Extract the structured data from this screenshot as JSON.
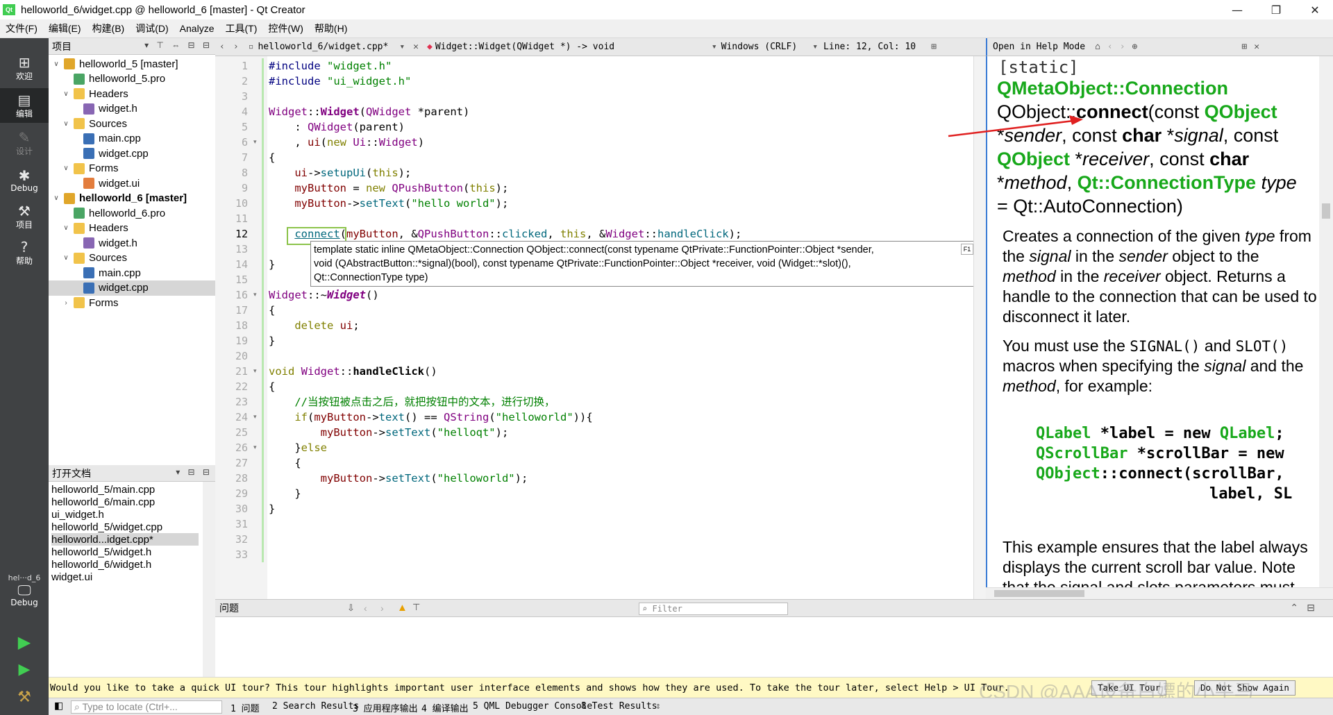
{
  "window": {
    "title": "helloworld_6/widget.cpp @ helloworld_6 [master] - Qt Creator",
    "minimize": "—",
    "maximize": "❐",
    "close": "✕",
    "logo": "Qt"
  },
  "menu": [
    "文件(F)",
    "编辑(E)",
    "构建(B)",
    "调试(D)",
    "Analyze",
    "工具(T)",
    "控件(W)",
    "帮助(H)"
  ],
  "modes": [
    {
      "label": "欢迎",
      "icon": "grid-icon"
    },
    {
      "label": "编辑",
      "icon": "edit-icon"
    },
    {
      "label": "设计",
      "icon": "pen-icon"
    },
    {
      "label": "Debug",
      "icon": "bug-icon"
    },
    {
      "label": "项目",
      "icon": "wrench-icon"
    },
    {
      "label": "帮助",
      "icon": "help-icon"
    }
  ],
  "kit": {
    "name": "hel···d_6",
    "label": "Debug"
  },
  "project_pane": {
    "title": "项目",
    "tree": [
      {
        "label": "helloworld_5 [master]",
        "depth": 0,
        "arrow": "∨",
        "icon": "proj",
        "bold": false
      },
      {
        "label": "helloworld_5.pro",
        "depth": 1,
        "arrow": "",
        "icon": "pro"
      },
      {
        "label": "Headers",
        "depth": 1,
        "arrow": "∨",
        "icon": "folder"
      },
      {
        "label": "widget.h",
        "depth": 2,
        "arrow": "",
        "icon": "h"
      },
      {
        "label": "Sources",
        "depth": 1,
        "arrow": "∨",
        "icon": "folder"
      },
      {
        "label": "main.cpp",
        "depth": 2,
        "arrow": "",
        "icon": "cpp"
      },
      {
        "label": "widget.cpp",
        "depth": 2,
        "arrow": "",
        "icon": "cpp"
      },
      {
        "label": "Forms",
        "depth": 1,
        "arrow": "∨",
        "icon": "folder"
      },
      {
        "label": "widget.ui",
        "depth": 2,
        "arrow": "",
        "icon": "ui"
      },
      {
        "label": "helloworld_6 [master]",
        "depth": 0,
        "arrow": "∨",
        "icon": "proj",
        "bold": true
      },
      {
        "label": "helloworld_6.pro",
        "depth": 1,
        "arrow": "",
        "icon": "pro"
      },
      {
        "label": "Headers",
        "depth": 1,
        "arrow": "∨",
        "icon": "folder"
      },
      {
        "label": "widget.h",
        "depth": 2,
        "arrow": "",
        "icon": "h"
      },
      {
        "label": "Sources",
        "depth": 1,
        "arrow": "∨",
        "icon": "folder"
      },
      {
        "label": "main.cpp",
        "depth": 2,
        "arrow": "",
        "icon": "cpp"
      },
      {
        "label": "widget.cpp",
        "depth": 2,
        "arrow": "",
        "icon": "cpp",
        "selected": true
      },
      {
        "label": "Forms",
        "depth": 1,
        "arrow": "›",
        "icon": "folder"
      }
    ]
  },
  "open_docs": {
    "title": "打开文档",
    "items": [
      {
        "label": "helloworld_5/main.cpp"
      },
      {
        "label": "helloworld_6/main.cpp"
      },
      {
        "label": "ui_widget.h"
      },
      {
        "label": "helloworld_5/widget.cpp"
      },
      {
        "label": "helloworld...idget.cpp*",
        "selected": true
      },
      {
        "label": "helloworld_5/widget.h"
      },
      {
        "label": "helloworld_6/widget.h"
      },
      {
        "label": "widget.ui"
      }
    ]
  },
  "editor": {
    "file": "helloworld_6/widget.cpp*",
    "symbol": "Widget::Widget(QWidget *) -> void",
    "encoding": "Windows (CRLF)",
    "position": "Line: 12, Col: 10",
    "line_numbers": [
      "1",
      "2",
      "3",
      "4",
      "5",
      "6",
      "7",
      "8",
      "9",
      "10",
      "11",
      "12",
      "13",
      "14",
      "15",
      "16",
      "17",
      "18",
      "19",
      "20",
      "21",
      "22",
      "23",
      "24",
      "25",
      "26",
      "27",
      "28",
      "29",
      "30",
      "31",
      "32",
      "33"
    ],
    "code": {
      "l1a": "#include",
      "l1b": " \"widget.h\"",
      "l2a": "#include",
      "l2b": " \"ui_widget.h\"",
      "l4a": "Widget",
      "l4b": "::",
      "l4c": "Widget",
      "l4d": "(",
      "l4e": "QWidget",
      "l4f": " *parent)",
      "l5a": "    : ",
      "l5b": "QWidget",
      "l5c": "(parent)",
      "l6a": "    , ",
      "l6b": "ui",
      "l6c": "(",
      "l6d": "new",
      "l6e": " ",
      "l6f": "Ui",
      "l6g": "::",
      "l6h": "Widget",
      "l6i": ")",
      "l7": "{",
      "l8a": "    ",
      "l8b": "ui",
      "l8c": "->",
      "l8d": "setupUi",
      "l8e": "(",
      "l8f": "this",
      "l8g": ");",
      "l9a": "    ",
      "l9b": "myButton",
      "l9c": " = ",
      "l9d": "new",
      "l9e": " ",
      "l9f": "QPushButton",
      "l9g": "(",
      "l9h": "this",
      "l9i": ");",
      "l10a": "    ",
      "l10b": "myButton",
      "l10c": "->",
      "l10d": "setText",
      "l10e": "(",
      "l10f": "\"hello world\"",
      "l10g": ");",
      "l12a": "    ",
      "l12b": "connect",
      "l12c": "(",
      "l12d": "myButton",
      "l12e": ", &",
      "l12f": "QPushButton",
      "l12g": "::",
      "l12h": "clicked",
      "l12i": ", ",
      "l12j": "this",
      "l12k": ", &",
      "l12l": "Widget",
      "l12m": "::",
      "l12n": "handleClick",
      "l12o": ");",
      "l14": "}",
      "l16a": "Widget",
      "l16b": "::~",
      "l16c": "Widget",
      "l16d": "()",
      "l17": "{",
      "l18a": "    ",
      "l18b": "delete",
      "l18c": " ",
      "l18d": "ui",
      "l18e": ";",
      "l19": "}",
      "l21a": "void",
      "l21b": " ",
      "l21c": "Widget",
      "l21d": "::",
      "l21e": "handleClick",
      "l21f": "()",
      "l22": "{",
      "l23": "    //当按钮被点击之后，就把按钮中的文本，进行切换，",
      "l24a": "    ",
      "l24b": "if",
      "l24c": "(",
      "l24d": "myButton",
      "l24e": "->",
      "l24f": "text",
      "l24g": "() == ",
      "l24h": "QString",
      "l24i": "(",
      "l24j": "\"helloworld\"",
      "l24k": ")){",
      "l25a": "        ",
      "l25b": "myButton",
      "l25c": "->",
      "l25d": "setText",
      "l25e": "(",
      "l25f": "\"helloqt\"",
      "l25g": ");",
      "l26a": "    }",
      "l26b": "else",
      "l27": "    {",
      "l28a": "        ",
      "l28b": "myButton",
      "l28c": "->",
      "l28d": "setText",
      "l28e": "(",
      "l28f": "\"helloworld\"",
      "l28g": ");",
      "l29": "    }",
      "l30": "}"
    },
    "tooltip": {
      "line1": "template static inline QMetaObject::Connection QObject::connect(const typename QtPrivate::FunctionPointer::Object *sender,",
      "line2": "void (QAbstractButton::*signal)(bool), const typename QtPrivate::FunctionPointer::Object *receiver, void (Widget::*slot)(),",
      "line3": "Qt::ConnectionType type)",
      "button": "F1"
    }
  },
  "help": {
    "toolbar": "Open in Help Mode",
    "static": "[static]",
    "ret": "QMetaObject::Connection",
    "s1a": "QObject::",
    "s1b": "connect",
    "s1c": "(const ",
    "s1d": "QObject",
    "s2a": "*",
    "s2b": "sender",
    "s2c": ", const ",
    "s2d": "char",
    "s2e": " *",
    "s2f": "signal",
    "s2g": ", const",
    "s3a": "QObject",
    "s3b": " *",
    "s3c": "receiver",
    "s3d": ", const ",
    "s3e": "char",
    "s4a": "*",
    "s4b": "method",
    "s4c": ", ",
    "s4d": "Qt::ConnectionType",
    "s4e": " ",
    "s4f": "type",
    "s5": "= Qt::AutoConnection)",
    "p1a": "Creates a connection of the given ",
    "p1b": "type",
    "p1c": " from",
    "p2a": "the ",
    "p2b": "signal",
    "p2c": " in the ",
    "p2d": "sender",
    "p2e": " object to the",
    "p3a": "method",
    "p3b": " in the ",
    "p3c": "receiver",
    "p3d": " object. Returns a",
    "p4": "handle to the connection that can be used to",
    "p5": "disconnect it later.",
    "q1a": "You must use the ",
    "q1b": "SIGNAL()",
    "q1c": " and ",
    "q1d": "SLOT()",
    "q2a": "macros when specifying the ",
    "q2b": "signal",
    "q2c": " and the",
    "q3a": "method",
    "q3b": ", for example:",
    "c1a": "QLabel",
    "c1b": " *label = new ",
    "c1c": "QLabel",
    "c1d": ";",
    "c2a": "QScrollBar",
    "c2b": " *scrollBar = new",
    "c3a": "QObject",
    "c3b": "::connect(scrollBar,",
    "c4": "label,  SL",
    "r1": "This example ensures that the label always",
    "r2": "displays the current scroll bar value. Note",
    "r3": "that the signal and slots parameters must"
  },
  "issues": {
    "title": "问题",
    "filter": "Filter"
  },
  "tour": {
    "text": "Would you like to take a quick UI tour? This tour highlights important user interface elements and shows how they are used. To take the tour later, select Help > UI Tour.",
    "take": "Take UI Tour",
    "dont": "Do Not Show Again"
  },
  "status": {
    "locate": "Type to locate (Ctrl+...",
    "tabs": [
      "1 问题",
      "2 Search Results",
      "3 应用程序输出",
      "4 编译输出",
      "5 QML Debugger Console",
      "8 Test Results"
    ]
  },
  "watermark": "CSDN @AAA设备白嫖的小牛马"
}
